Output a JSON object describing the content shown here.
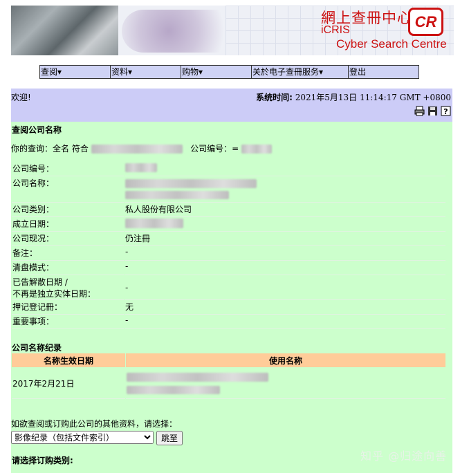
{
  "banner": {
    "title_zh": "網上查冊中心",
    "title_en": "iCRIS",
    "subtitle": "Cyber Search Centre",
    "logo": "CR"
  },
  "nav": [
    {
      "label": "查阅▾"
    },
    {
      "label": "资料▾"
    },
    {
      "label": "购物▾"
    },
    {
      "label": "关於电子查冊服务▾"
    },
    {
      "label": "登出"
    }
  ],
  "welcome": {
    "greeting": "欢迎!",
    "time_label": "系统时间:",
    "time_value": "2021年5月13日 11:14:17 GMT +0800",
    "icons": [
      "print-icon",
      "save-icon",
      "help-icon"
    ]
  },
  "search": {
    "heading": "查阅公司名称",
    "query_label": "你的查询：全名 符合",
    "company_no_label": "公司编号：",
    "company_no_prefix": "="
  },
  "info_rows": [
    {
      "label": "公司编号：",
      "value": ""
    },
    {
      "label": "公司名称：",
      "value": ""
    },
    {
      "label": "公司类别：",
      "value": "私人股份有限公司"
    },
    {
      "label": "成立日期：",
      "value": ""
    },
    {
      "label": "公司现况：",
      "value": "仍注冊"
    },
    {
      "label": "备注：",
      "value": "-"
    },
    {
      "label": "清盘模式：",
      "value": "-"
    },
    {
      "label": "已告解散日期 /",
      "label2": "不再是独立实体日期：",
      "value": "-"
    },
    {
      "label": "押记登记冊：",
      "value": "无"
    },
    {
      "label": "重要事项：",
      "value": "-"
    }
  ],
  "name_history": {
    "heading": "公司名称纪录",
    "col_date": "名称生效日期",
    "col_name": "使用名称",
    "rows": [
      {
        "date": "2017年2月21日",
        "name": ""
      }
    ]
  },
  "other_info": {
    "prompt": "如欲查阅或订购此公司的其他资料，请选择：",
    "selected": "影像纪录（包括文件索引）",
    "go_label": "跳至"
  },
  "order": {
    "heading": "请选择订购类别:"
  },
  "watermark": "知乎 @归途向善"
}
